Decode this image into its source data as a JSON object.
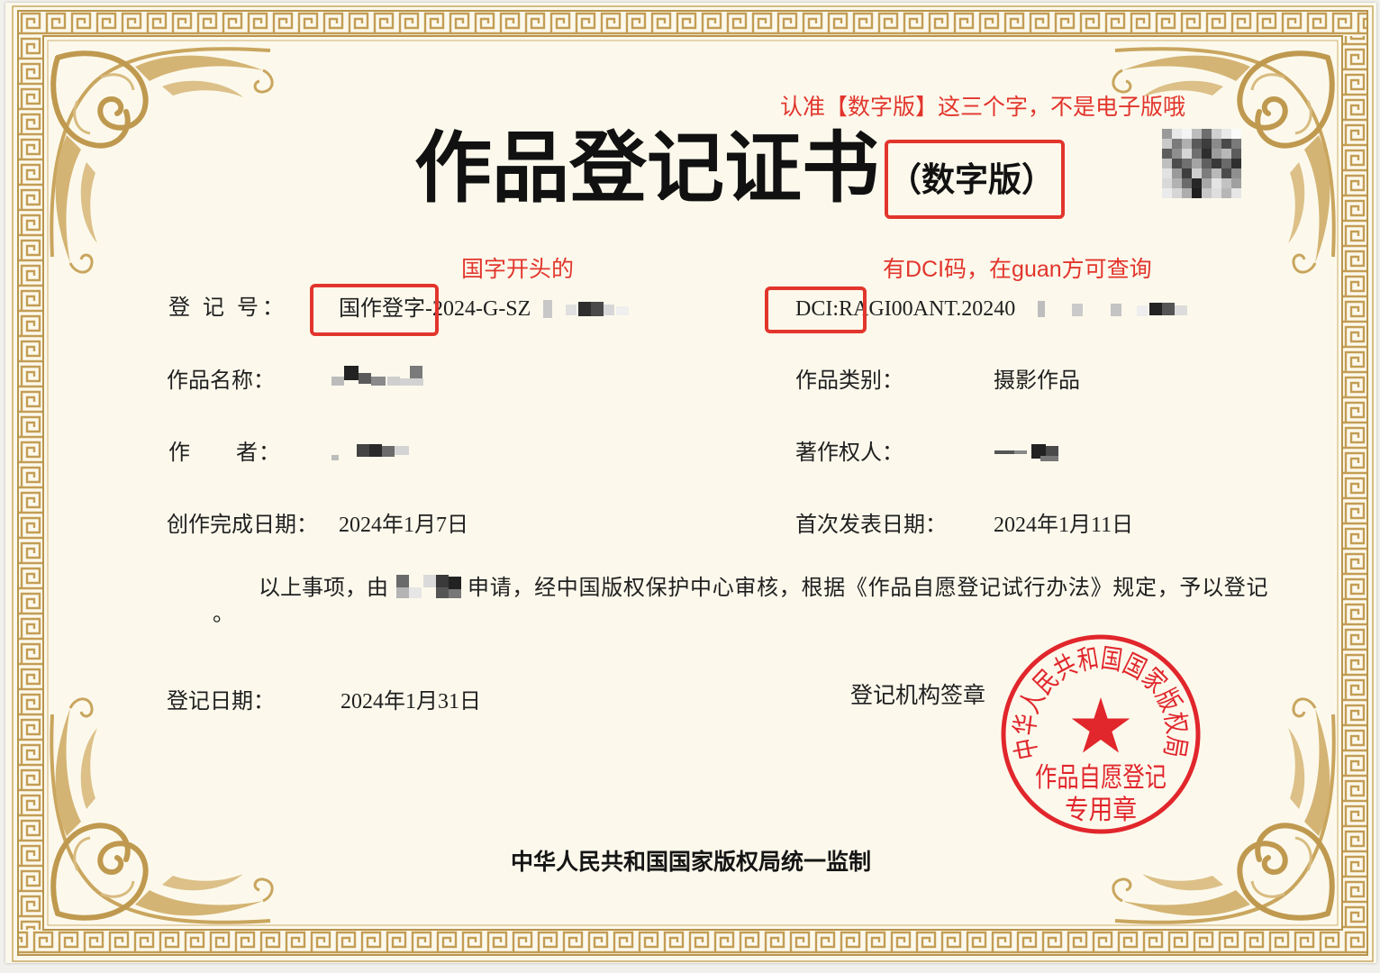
{
  "annotations": {
    "digital_version_note": "认准【数字版】这三个字，不是电子版哦",
    "guo_prefix_note": "国字开头的",
    "dci_note": "有DCI码，在guan方可查询"
  },
  "certificate": {
    "title": "作品登记证书",
    "edition": "（数字版）",
    "fields": {
      "reg_no_label": "登 记 号：",
      "reg_no_value": "国作登字-2024-G-SZ",
      "dci_value": "DCI:RAGI00ANT.20240",
      "work_name_label": "作品名称：",
      "work_type_label": "作品类别：",
      "work_type_value": "摄影作品",
      "author_label": "作　　者：",
      "owner_label": "著作权人：",
      "creation_date_label": "创作完成日期：",
      "creation_date_value": "2024年1月7日",
      "publish_date_label": "首次发表日期：",
      "publish_date_value": "2024年1月11日"
    },
    "statement": {
      "before": "以上事项，由",
      "after": "申请，经中国版权保护中心审核，根据《作品自愿登记试行办法》规定，予以登记",
      "end": "。"
    },
    "reg_date_label": "登记日期：",
    "reg_date_value": "2024年1月31日",
    "seal_label": "登记机构签章",
    "seal": {
      "ring_text": "中华人民共和国国家版权局",
      "center_text": "作品自愿登记",
      "bottom_text": "专用章"
    },
    "footer": "中华人民共和国国家版权局统一监制"
  },
  "colors": {
    "annotation_red": "#e2352c",
    "seal_red": "#e1262c",
    "gold": "#c39d55",
    "paper": "#fcf9ec"
  }
}
